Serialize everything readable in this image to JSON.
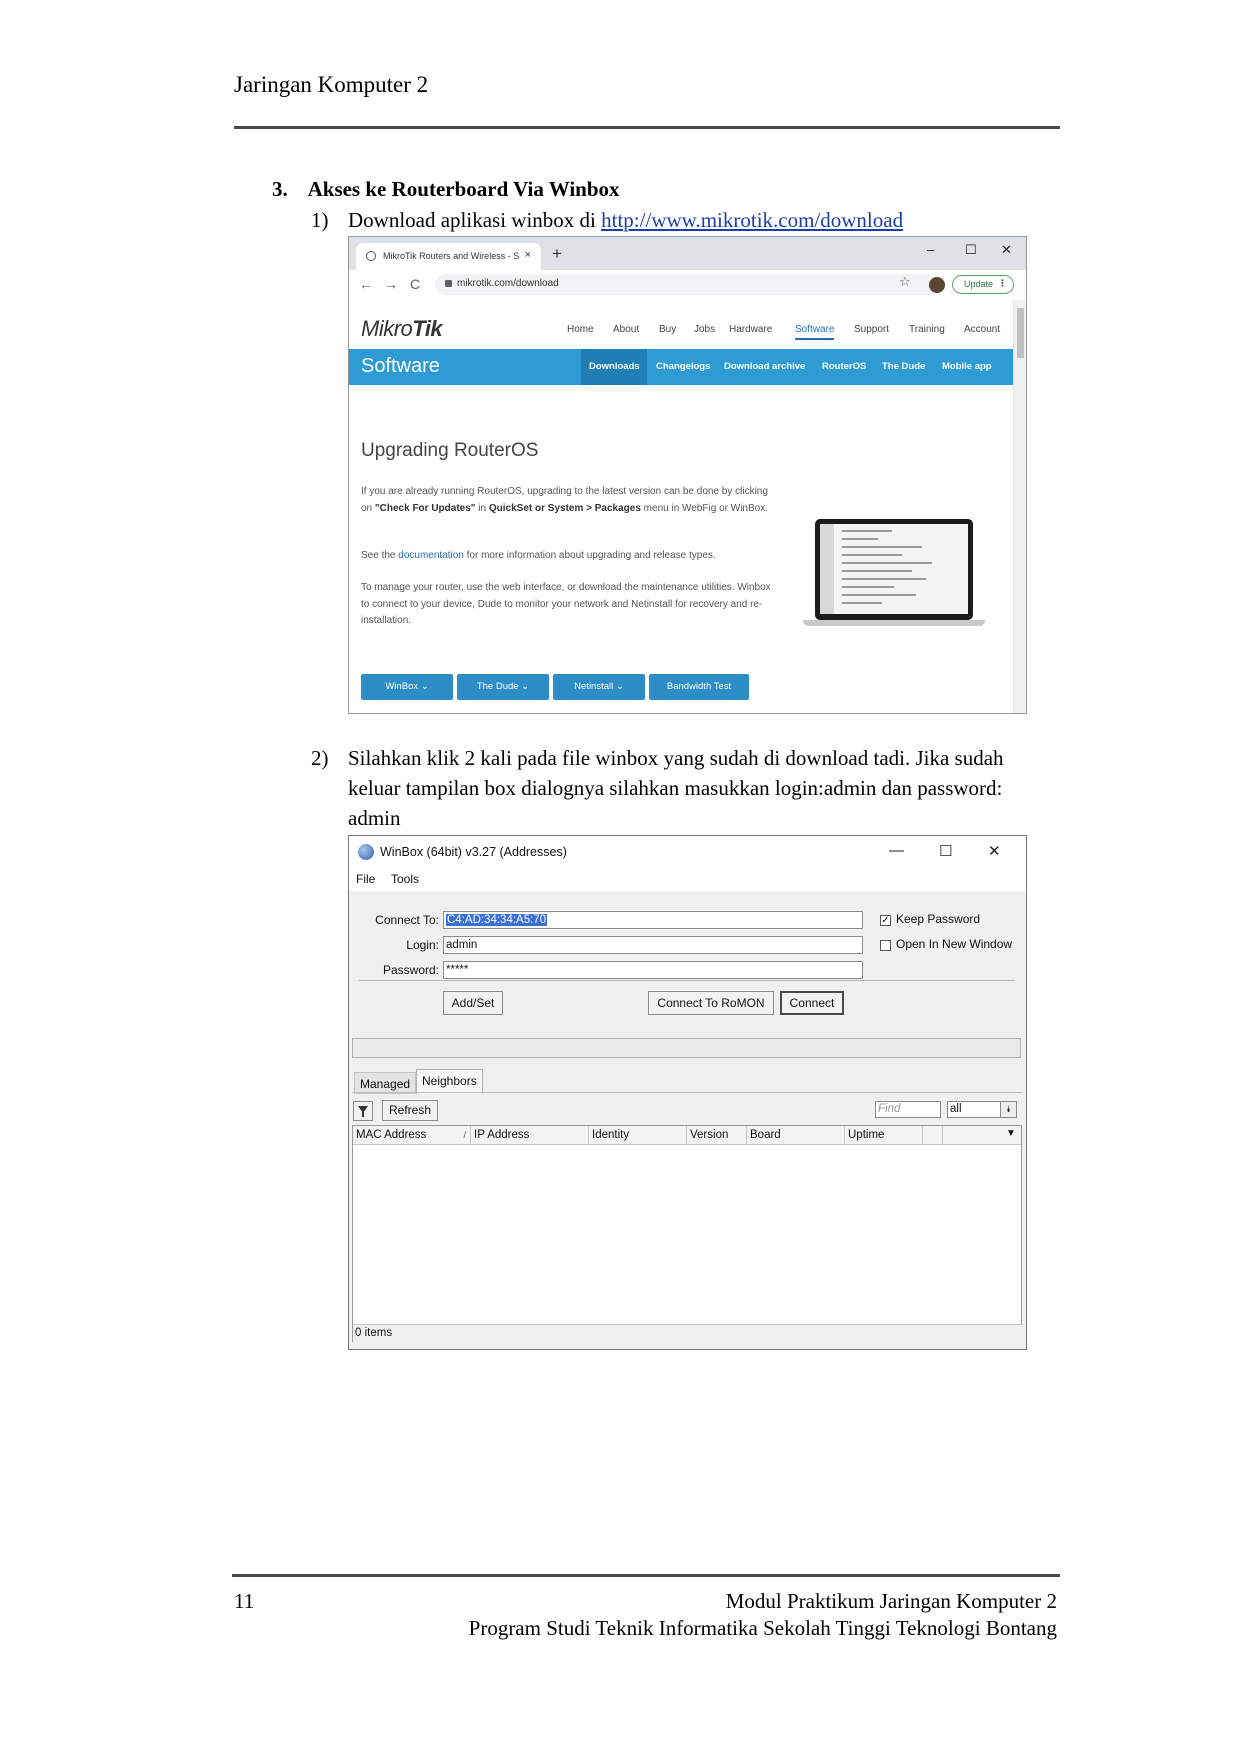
{
  "header": {
    "title": "Jaringan Komputer 2"
  },
  "section": {
    "number": "3.",
    "title": "Akses ke Routerboard Via Winbox"
  },
  "step1": {
    "number": "1)",
    "text": "Download aplikasi winbox di ",
    "link": "http://www.mikrotik.com/download"
  },
  "browser": {
    "tab_title": "MikroTik Routers and Wireless - S",
    "tab_close": "×",
    "new_tab": "+",
    "win_minimize": "–",
    "win_maximize": "☐",
    "win_close": "✕",
    "back": "←",
    "forward": "→",
    "reload": "C",
    "url": "mikrotik.com/download",
    "star": "☆",
    "update_label": "Update",
    "menu_dots": "⋮",
    "site": {
      "logo_light": "Mikro",
      "logo_bold": "Tik",
      "nav": [
        "Home",
        "About",
        "Buy",
        "Jobs",
        "Hardware",
        "Software",
        "Support",
        "Training",
        "Account"
      ],
      "nav_active": "Software",
      "band_title": "Software",
      "subnav": [
        "Downloads",
        "Changelogs",
        "Download archive",
        "RouterOS",
        "The Dude",
        "Mobile app"
      ],
      "heading": "Upgrading RouterOS",
      "para1_a": "If you are already running RouterOS, upgrading to the latest version can be done by clicking on ",
      "para1_b": "\"Check For Updates\"",
      "para1_c": " in ",
      "para1_d": "QuickSet or System > Packages",
      "para1_e": " menu in WebFig or WinBox.",
      "para2_a": "See the ",
      "para2_link": "documentation",
      "para2_b": " for more information about upgrading and release types.",
      "para3": "To manage your router, use the web interface, or download the maintenance utilities. Winbox to connect to your device, Dude to monitor your network and Netinstall for recovery and re-installation.",
      "buttons": [
        "WinBox ⌄",
        "The Dude ⌄",
        "Netinstall ⌄",
        "Bandwidth Test"
      ]
    }
  },
  "step2": {
    "number": "2)",
    "text": "Silahkan klik 2 kali pada file winbox yang sudah di download tadi. Jika sudah keluar tampilan box dialognya silahkan masukkan login:admin dan password: admin"
  },
  "winbox": {
    "title": "WinBox (64bit) v3.27 (Addresses)",
    "win_minimize": "—",
    "win_maximize": "☐",
    "win_close": "✕",
    "menu": [
      "File",
      "Tools"
    ],
    "connect_to_label": "Connect To:",
    "connect_to_value": "C4:AD:34:34:A5:70",
    "login_label": "Login:",
    "login_value": "admin",
    "password_label": "Password:",
    "password_value": "*****",
    "keep_password": "Keep Password",
    "keep_password_mark": "✓",
    "open_new_window": "Open In New Window",
    "add_set": "Add/Set",
    "connect_romon": "Connect To RoMON",
    "connect": "Connect",
    "tab_managed": "Managed",
    "tab_neighbors": "Neighbors",
    "refresh": "Refresh",
    "find_placeholder": "Find",
    "filter_value": "all",
    "filter_btn": "⯯",
    "columns": [
      "MAC Address",
      "IP Address",
      "Identity",
      "Version",
      "Board",
      "Uptime"
    ],
    "sort_mark": "/",
    "col_menu": "▼",
    "footer": "0 items"
  },
  "footer": {
    "page_number": "11",
    "line1": "Modul Praktikum Jaringan Komputer 2",
    "line2": "Program Studi Teknik Informatika Sekolah Tinggi Teknologi Bontang"
  }
}
